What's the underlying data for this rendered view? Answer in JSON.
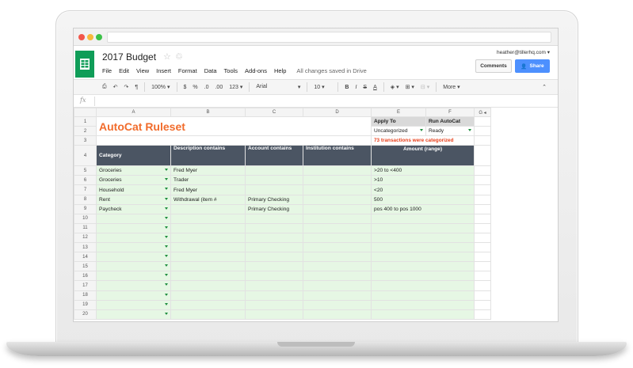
{
  "header": {
    "doc_title": "2017 Budget",
    "menus": [
      "File",
      "Edit",
      "View",
      "Insert",
      "Format",
      "Data",
      "Tools",
      "Add-ons",
      "Help"
    ],
    "save_status": "All changes saved in Drive",
    "user_email": "heather@tillerhq.com",
    "comments_label": "Comments",
    "share_label": "Share"
  },
  "toolbar": {
    "zoom": "100%",
    "currency": "$",
    "percent": "%",
    "decimal_less": ".0",
    "decimal_more": ".00",
    "number_format": "123",
    "font": "Arial",
    "font_size": "10",
    "bold": "B",
    "italic": "I",
    "strikethrough": "S",
    "text_color": "A",
    "more_label": "More"
  },
  "formula": {
    "fx_label": "fx"
  },
  "sheet": {
    "columns": [
      "A",
      "B",
      "C",
      "D",
      "E",
      "F",
      "G"
    ],
    "title": "AutoCat Ruleset",
    "apply_to_label": "Apply To",
    "apply_to_value": "Uncategorized",
    "run_label": "Run AutoCat",
    "run_value": "Ready",
    "status_note": "73 transactions were categorized",
    "headers": {
      "category": "Category",
      "description": "Description contains",
      "account": "Account contains",
      "institution": "Institution contains",
      "amount": "Amount (range)"
    },
    "row_numbers": [
      "1",
      "2",
      "3",
      "4",
      "5",
      "6",
      "7",
      "8",
      "9",
      "10",
      "11",
      "12",
      "13",
      "14",
      "15",
      "16",
      "17",
      "18",
      "19",
      "20"
    ],
    "rules": [
      {
        "category": "Groceries",
        "description": "Fred Myer",
        "account": "",
        "institution": "",
        "amount": ">20 to <400"
      },
      {
        "category": "Groceries",
        "description": "Trader",
        "account": "",
        "institution": "",
        "amount": ">10"
      },
      {
        "category": "Household",
        "description": "Fred Myer",
        "account": "",
        "institution": "",
        "amount": "<20"
      },
      {
        "category": "Rent",
        "description": "Withdrawal (item #",
        "account": "Primary Checking",
        "institution": "",
        "amount": "500"
      },
      {
        "category": "Paycheck",
        "description": "",
        "account": "Primary Checking",
        "institution": "",
        "amount": "pos 400 to pos 1000"
      }
    ]
  }
}
